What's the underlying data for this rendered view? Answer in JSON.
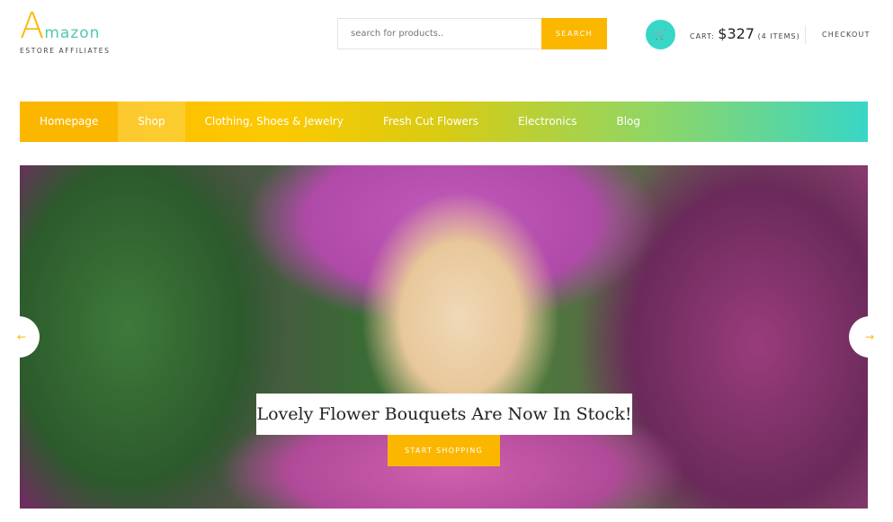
{
  "brand": {
    "letter": "A",
    "rest": "mazon",
    "tagline": "ESTORE AFFILIATES"
  },
  "search": {
    "placeholder": "search for products..",
    "button": "SEARCH"
  },
  "cart": {
    "icon": "cart-icon",
    "label": "CART:",
    "amount": "$327",
    "items": "(4 ITEMS)",
    "checkout": "CHECKOUT"
  },
  "nav": {
    "items": [
      {
        "label": "Homepage"
      },
      {
        "label": "Shop"
      },
      {
        "label": "Clothing, Shoes & Jewelry"
      },
      {
        "label": "Fresh Cut Flowers"
      },
      {
        "label": "Electronics"
      },
      {
        "label": "Blog"
      }
    ]
  },
  "hero": {
    "caption": "Lovely Flower Bouquets Are Now In Stock!",
    "button": "START SHOPPING",
    "prev_icon": "arrow-left-icon",
    "next_icon": "arrow-right-icon"
  },
  "colors": {
    "accent": "#fbb700",
    "teal": "#38d6c6"
  }
}
